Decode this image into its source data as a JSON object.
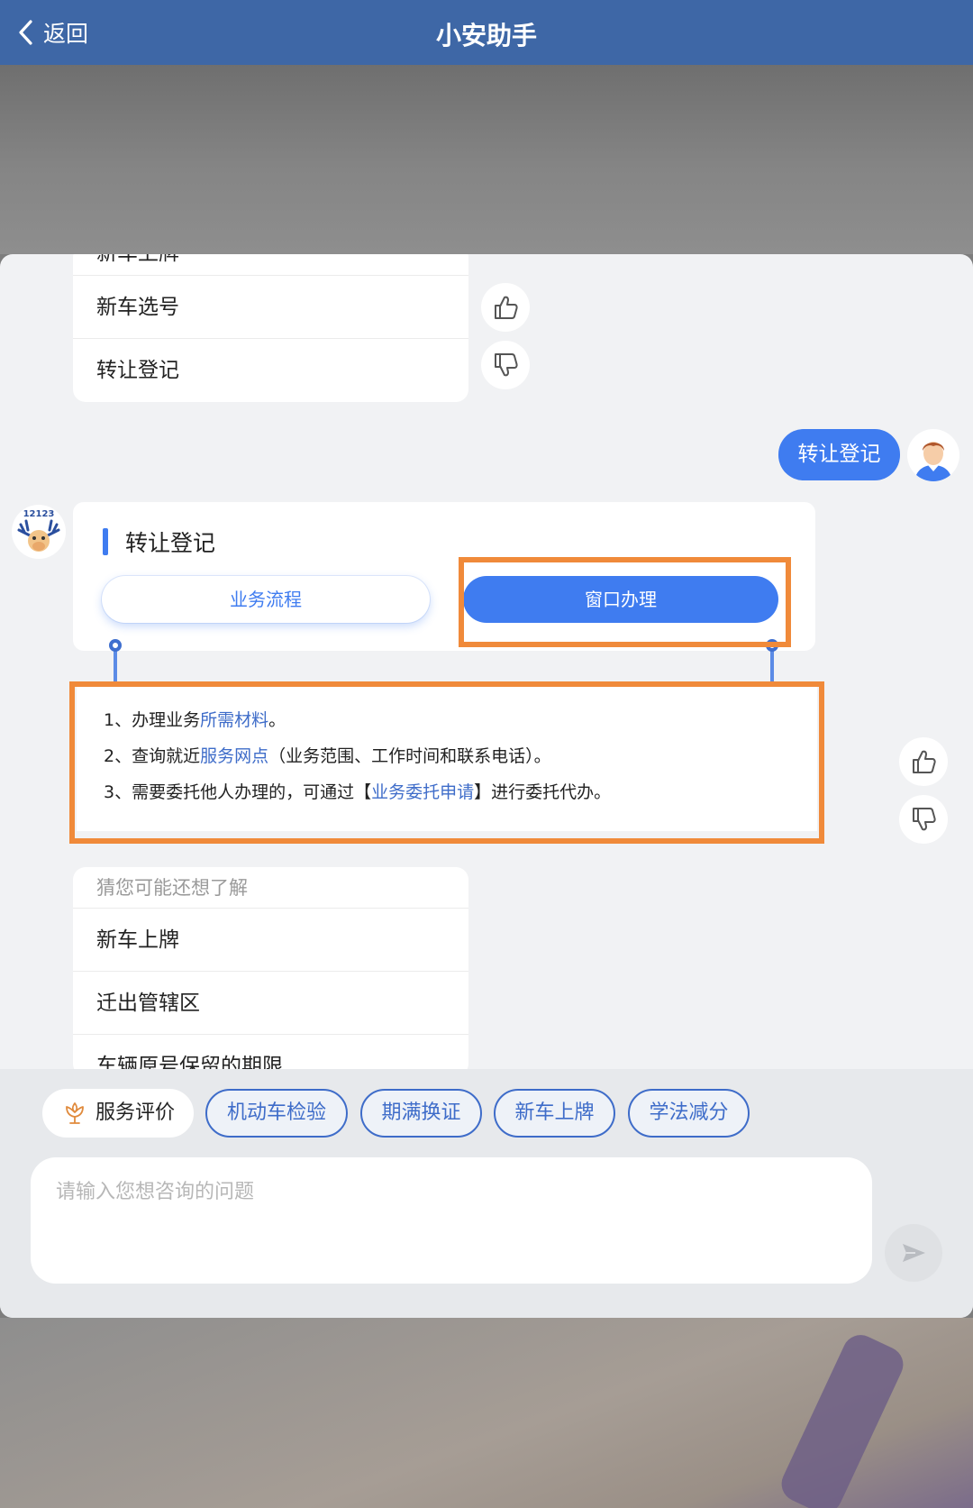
{
  "nav": {
    "back_label": "返回",
    "title": "小安助手"
  },
  "top_menu": {
    "items": [
      "新车上牌",
      "新车选号",
      "转让登记"
    ]
  },
  "user_message": "转让登记",
  "topic_card": {
    "title": "转让登记",
    "tabs": [
      "业务流程",
      "窗口办理"
    ],
    "selected_tab": "窗口办理"
  },
  "info": {
    "line1": {
      "prefix": "1、办理业务",
      "link": "所需材料",
      "suffix": "。"
    },
    "line2": {
      "prefix": "2、查询就近",
      "link": "服务网点",
      "suffix": "（业务范围、工作时间和联系电话）。"
    },
    "line3": {
      "prefix": "3、需要委托他人办理的，可通过【",
      "link": "业务委托申请",
      "suffix": "】进行委托代办。"
    }
  },
  "suggestions": {
    "heading": "猜您可能还想了解",
    "items": [
      "新车上牌",
      "迁出管辖区",
      "车辆原号保留的期限"
    ]
  },
  "quick_chips": {
    "rate_label": "服务评价",
    "items": [
      "机动车检验",
      "期满换证",
      "新车上牌",
      "学法减分"
    ]
  },
  "input": {
    "placeholder": "请输入您想咨询的问题",
    "value": ""
  },
  "colors": {
    "nav_bar": "#3e67a6",
    "accent": "#3f7cf0",
    "link": "#3e6cc9",
    "annotation": "#f08a3a"
  },
  "icons": {
    "back": "chevron-left-icon",
    "like": "thumb-up-icon",
    "dislike": "thumb-down-icon",
    "rate": "flower-icon",
    "send": "send-icon"
  }
}
